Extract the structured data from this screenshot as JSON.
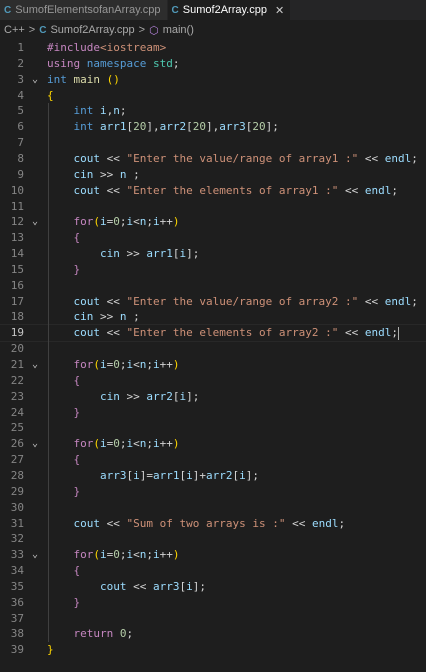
{
  "tabs": [
    {
      "icon": "C",
      "label": "SumofElementsofanArray.cpp",
      "active": false
    },
    {
      "icon": "C",
      "label": "Sumof2Array.cpp",
      "active": true,
      "close": "✕"
    }
  ],
  "breadcrumbs": {
    "lang": "C++",
    "sep1": ">",
    "file": "Sumof2Array.cpp",
    "sep2": ">",
    "symbol": "main()"
  },
  "editor": {
    "current_line": 19,
    "lines": [
      {
        "n": "1",
        "fold": "",
        "html": "<span class='kc'>#include</span><span class='s'>&lt;iostream&gt;</span>"
      },
      {
        "n": "2",
        "fold": "",
        "html": "<span class='kc'>using</span> <span class='k'>namespace</span> <span class='t'>std</span>;"
      },
      {
        "n": "3",
        "fold": "v",
        "html": "<span class='k'>int</span> <span class='f'>main</span> <span class='br'>()</span>"
      },
      {
        "n": "4",
        "fold": "",
        "html": "<span class='br'>{</span>"
      },
      {
        "n": "5",
        "fold": "",
        "html": "    <span class='k'>int</span> <span class='v'>i</span>,<span class='v'>n</span>;"
      },
      {
        "n": "6",
        "fold": "",
        "html": "    <span class='k'>int</span> <span class='v'>arr1</span>[<span class='n'>20</span>],<span class='v'>arr2</span>[<span class='n'>20</span>],<span class='v'>arr3</span>[<span class='n'>20</span>];"
      },
      {
        "n": "7",
        "fold": "",
        "html": ""
      },
      {
        "n": "8",
        "fold": "",
        "html": "    <span class='v'>cout</span> &lt;&lt; <span class='s'>\"Enter the value/range of array1 :\"</span> &lt;&lt; <span class='v'>endl</span>;"
      },
      {
        "n": "9",
        "fold": "",
        "html": "    <span class='v'>cin</span> &gt;&gt; <span class='v'>n</span> ;"
      },
      {
        "n": "10",
        "fold": "",
        "html": "    <span class='v'>cout</span> &lt;&lt; <span class='s'>\"Enter the elements of array1 :\"</span> &lt;&lt; <span class='v'>endl</span>;"
      },
      {
        "n": "11",
        "fold": "",
        "html": ""
      },
      {
        "n": "12",
        "fold": "v",
        "html": "    <span class='kc'>for</span><span class='br'>(</span><span class='v'>i</span>=<span class='n'>0</span>;<span class='v'>i</span>&lt;<span class='v'>n</span>;<span class='v'>i</span>++<span class='br'>)</span>"
      },
      {
        "n": "13",
        "fold": "",
        "html": "    <span class='kc'>{</span>"
      },
      {
        "n": "14",
        "fold": "",
        "html": "        <span class='v'>cin</span> &gt;&gt; <span class='v'>arr1</span>[<span class='v'>i</span>];"
      },
      {
        "n": "15",
        "fold": "",
        "html": "    <span class='kc'>}</span>"
      },
      {
        "n": "16",
        "fold": "",
        "html": ""
      },
      {
        "n": "17",
        "fold": "",
        "html": "    <span class='v'>cout</span> &lt;&lt; <span class='s'>\"Enter the value/range of array2 :\"</span> &lt;&lt; <span class='v'>endl</span>;"
      },
      {
        "n": "18",
        "fold": "",
        "html": "    <span class='v'>cin</span> &gt;&gt; <span class='v'>n</span> ;"
      },
      {
        "n": "19",
        "fold": "",
        "html": "    <span class='v'>cout</span> &lt;&lt; <span class='s'>\"Enter the elements of array2 :\"</span> &lt;&lt; <span class='v'>endl</span>;<span class='caret'></span>"
      },
      {
        "n": "20",
        "fold": "",
        "html": ""
      },
      {
        "n": "21",
        "fold": "v",
        "html": "    <span class='kc'>for</span><span class='br'>(</span><span class='v'>i</span>=<span class='n'>0</span>;<span class='v'>i</span>&lt;<span class='v'>n</span>;<span class='v'>i</span>++<span class='br'>)</span>"
      },
      {
        "n": "22",
        "fold": "",
        "html": "    <span class='kc'>{</span>"
      },
      {
        "n": "23",
        "fold": "",
        "html": "        <span class='v'>cin</span> &gt;&gt; <span class='v'>arr2</span>[<span class='v'>i</span>];"
      },
      {
        "n": "24",
        "fold": "",
        "html": "    <span class='kc'>}</span>"
      },
      {
        "n": "25",
        "fold": "",
        "html": ""
      },
      {
        "n": "26",
        "fold": "v",
        "html": "    <span class='kc'>for</span><span class='br'>(</span><span class='v'>i</span>=<span class='n'>0</span>;<span class='v'>i</span>&lt;<span class='v'>n</span>;<span class='v'>i</span>++<span class='br'>)</span>"
      },
      {
        "n": "27",
        "fold": "",
        "html": "    <span class='kc'>{</span>"
      },
      {
        "n": "28",
        "fold": "",
        "html": "        <span class='v'>arr3</span>[<span class='v'>i</span>]=<span class='v'>arr1</span>[<span class='v'>i</span>]+<span class='v'>arr2</span>[<span class='v'>i</span>];"
      },
      {
        "n": "29",
        "fold": "",
        "html": "    <span class='kc'>}</span>"
      },
      {
        "n": "30",
        "fold": "",
        "html": ""
      },
      {
        "n": "31",
        "fold": "",
        "html": "    <span class='v'>cout</span> &lt;&lt; <span class='s'>\"Sum of two arrays is :\"</span> &lt;&lt; <span class='v'>endl</span>;"
      },
      {
        "n": "32",
        "fold": "",
        "html": ""
      },
      {
        "n": "33",
        "fold": "v",
        "html": "    <span class='kc'>for</span><span class='br'>(</span><span class='v'>i</span>=<span class='n'>0</span>;<span class='v'>i</span>&lt;<span class='v'>n</span>;<span class='v'>i</span>++<span class='br'>)</span>"
      },
      {
        "n": "34",
        "fold": "",
        "html": "    <span class='kc'>{</span>"
      },
      {
        "n": "35",
        "fold": "",
        "html": "        <span class='v'>cout</span> &lt;&lt; <span class='v'>arr3</span>[<span class='v'>i</span>];"
      },
      {
        "n": "36",
        "fold": "",
        "html": "    <span class='kc'>}</span>"
      },
      {
        "n": "37",
        "fold": "",
        "html": ""
      },
      {
        "n": "38",
        "fold": "",
        "html": "    <span class='kc'>return</span> <span class='n'>0</span>;"
      },
      {
        "n": "39",
        "fold": "",
        "html": "<span class='br'>}</span>"
      }
    ]
  }
}
